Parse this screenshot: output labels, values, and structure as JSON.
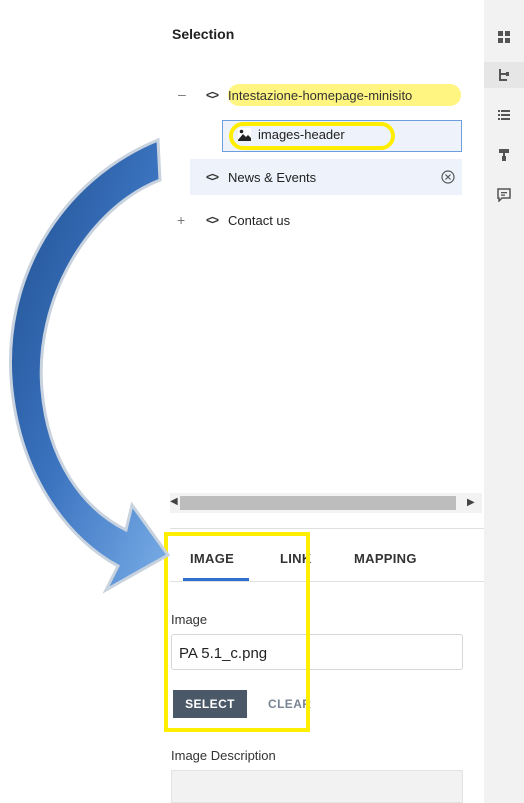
{
  "toolbar": {
    "icons": [
      "grid-icon",
      "tree-icon",
      "list-icon",
      "paint-roller-icon",
      "comment-icon"
    ],
    "active": "tree-icon"
  },
  "selection": {
    "title": "Selection",
    "tree": [
      {
        "label": "Intestazione-homepage-minisito",
        "icon": "code-icon",
        "expander": "–",
        "highlighted": true
      },
      {
        "label": "images-header",
        "icon": "image-icon",
        "selected": true
      },
      {
        "label": "News & Events",
        "icon": "code-icon",
        "action_icon": "remove-circle-icon"
      },
      {
        "label": "Contact us",
        "icon": "code-icon",
        "expander": "+"
      }
    ]
  },
  "scrollbar": {
    "left": "◀",
    "right": "▶"
  },
  "tabs": {
    "items": [
      "IMAGE",
      "LINK",
      "MAPPING"
    ],
    "active": "IMAGE"
  },
  "image_section": {
    "label": "Image",
    "value": "PA 5.1_c.png",
    "select_label": "SELECT",
    "clear_label": "CLEAR"
  },
  "description": {
    "label": "Image Description",
    "value": ""
  },
  "colors": {
    "highlight": "#fff36a",
    "annotation_yellow": "#ffee00",
    "selected_border": "#6e9dde",
    "tab_accent": "#2f6fcf",
    "button_bg": "#4b5868",
    "arrow_blue": "#3a6fb5"
  }
}
